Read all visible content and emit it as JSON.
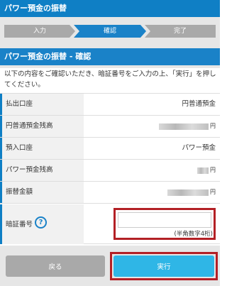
{
  "header": {
    "title": "パワー預金の振替"
  },
  "steps": [
    {
      "label": "入力",
      "active": false
    },
    {
      "label": "確認",
      "active": true
    },
    {
      "label": "完了",
      "active": false
    }
  ],
  "colors": {
    "primary": "#0f7fc5",
    "active_step": "#1a82c8",
    "inactive_step": "#a9a9a9",
    "highlight": "#b32025",
    "run_button": "#2fb6e6"
  },
  "section": {
    "title": "パワー預金の振替 - 確認"
  },
  "intro": "以下の内容をご確認いただき、暗証番号をご入力の上、「実行」を押してください。",
  "rows": [
    {
      "label": "払出口座",
      "value": "円普通預金"
    },
    {
      "label": "円普通預金残高",
      "value": "",
      "unit": "円"
    },
    {
      "label": "預入口座",
      "value": "パワー預金"
    },
    {
      "label": "パワー預金残高",
      "value": "",
      "unit": "円"
    },
    {
      "label": "振替金額",
      "value": "",
      "unit": "円"
    }
  ],
  "pin": {
    "label": "暗証番号",
    "help_icon": "?",
    "value": "",
    "hint": "(半角数字4桁)"
  },
  "buttons": {
    "back": "戻る",
    "run": "実行"
  }
}
